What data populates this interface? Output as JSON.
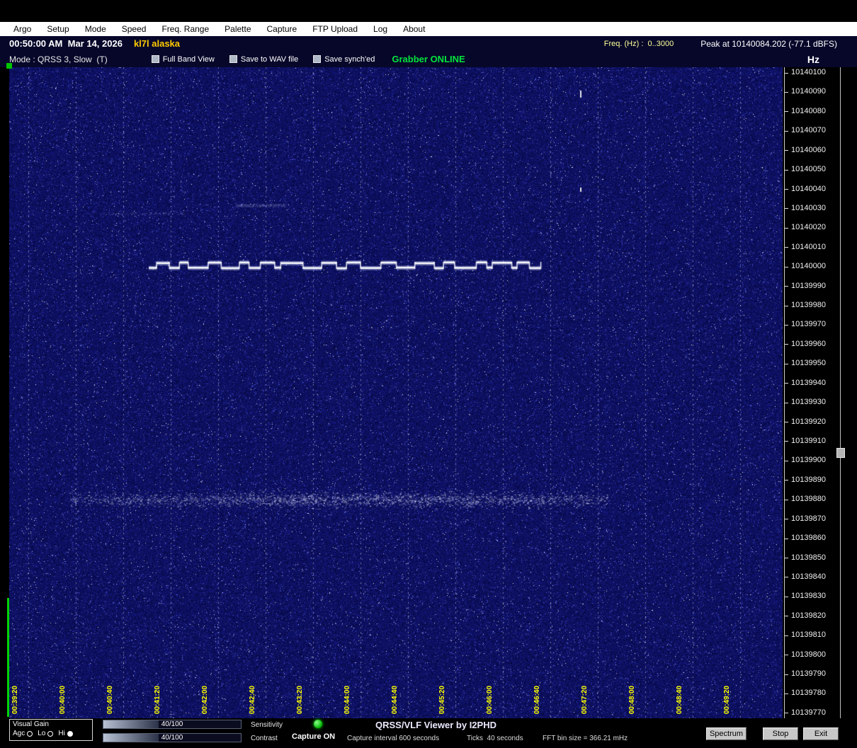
{
  "menu": {
    "items": [
      "Argo",
      "Setup",
      "Mode",
      "Speed",
      "Freq. Range",
      "Palette",
      "Capture",
      "FTP Upload",
      "Log",
      "About"
    ]
  },
  "titlebar": {
    "datetime": "00:50:00 AM  Mar 14, 2026",
    "callsign": "kl7l alaska",
    "freq_range_label": "Freq. (Hz) :  0..3000",
    "peak_label": "Peak at 10140084.202 (-77.1 dBFS)"
  },
  "modebar": {
    "mode_label": "Mode : QRSS 3, Slow  (T)",
    "checkboxes": [
      {
        "label": "Full Band View",
        "checked": false
      },
      {
        "label": "Save to WAV file",
        "checked": false
      },
      {
        "label": "Save synch'ed",
        "checked": false
      }
    ],
    "grabber_status": "Grabber ONLINE",
    "unit_label": "Hz"
  },
  "freq_scale": {
    "ticks": [
      "10140100",
      "10140090",
      "10140080",
      "10140070",
      "10140060",
      "10140050",
      "10140040",
      "10140030",
      "10140020",
      "10140010",
      "10140000",
      "10139990",
      "10139980",
      "10139970",
      "10139960",
      "10139950",
      "10139940",
      "10139930",
      "10139920",
      "10139910",
      "10139900",
      "10139890",
      "10139880",
      "10139870",
      "10139860",
      "10139850",
      "10139840",
      "10139830",
      "10139820",
      "10139810",
      "10139800",
      "10139790",
      "10139780",
      "10139770"
    ]
  },
  "time_labels": [
    "00:39:20",
    "00:40:00",
    "00:40:40",
    "00:41:20",
    "00:42:00",
    "00:42:40",
    "00:43:20",
    "00:44:00",
    "00:44:40",
    "00:45:20",
    "00:46:00",
    "00:46:40",
    "00:47:20",
    "00:48:00",
    "00:48:40",
    "00:49:20"
  ],
  "spectrogram": {
    "signal_trace_freq_hz": 10140000,
    "noise_band_freq_hz": 10139880
  },
  "statusbar": {
    "visual_gain": {
      "label": "Visual Gain",
      "options": [
        {
          "label": "Agc",
          "selected": false
        },
        {
          "label": "Lo",
          "selected": false
        },
        {
          "label": "Hi",
          "selected": true
        }
      ]
    },
    "sensitivity": {
      "label": "Sensitivity",
      "value": "40/100"
    },
    "contrast": {
      "label": "Contrast",
      "value": "40/100"
    },
    "capture_state": "Capture ON",
    "app_title": "QRSS/VLF Viewer by I2PHD",
    "capture_interval": "Capture interval 600 seconds",
    "ticks_label": "Ticks  40 seconds",
    "fft_label": "FFT bin size = 366.21 mHz",
    "buttons": [
      {
        "label": "Spectrum"
      },
      {
        "label": "Stop"
      },
      {
        "label": "Exit"
      }
    ]
  }
}
